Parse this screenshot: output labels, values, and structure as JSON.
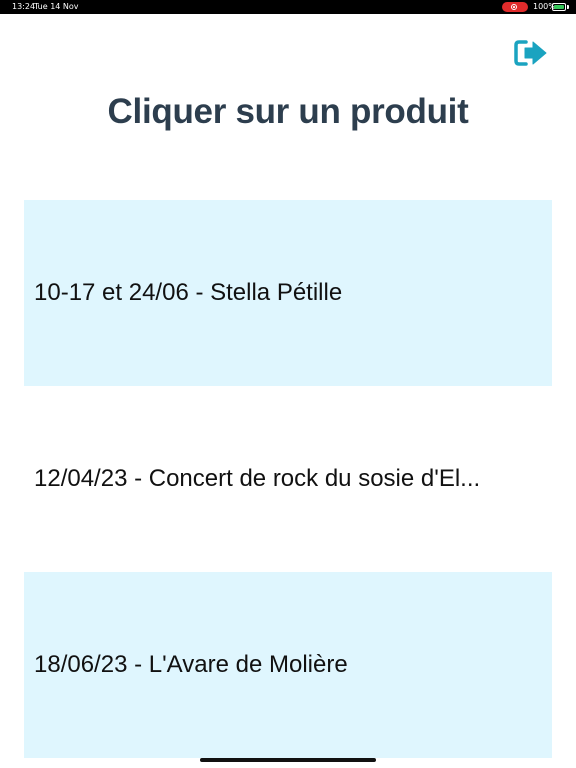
{
  "status_bar": {
    "time": "13:24",
    "date": "Tue 14 Nov",
    "battery_text": "100%",
    "recording_icon": "screen-record-icon",
    "battery_icon": "battery-charging-icon"
  },
  "header": {
    "logout_icon": "logout-icon",
    "title": "Cliquer sur un produit"
  },
  "products": [
    {
      "label": "10-17 et 24/06 - Stella Pétille"
    },
    {
      "label": "12/04/23 - Concert de rock du sosie d'El..."
    },
    {
      "label": "18/06/23 - L'Avare de Molière"
    }
  ],
  "colors": {
    "accent": "#1aa3c0",
    "title": "#2d3e4e",
    "row_highlight": "#dff6fe",
    "record": "#e02b2b",
    "battery": "#35c759"
  }
}
